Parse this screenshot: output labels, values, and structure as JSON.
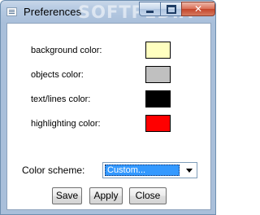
{
  "window": {
    "title": "Preferences",
    "watermark": "SOFTPEDIA"
  },
  "properties": [
    {
      "label": "background color:",
      "color": "#ffffc0"
    },
    {
      "label": "objects color:",
      "color": "#c0c0c0"
    },
    {
      "label": "text/lines color:",
      "color": "#000000"
    },
    {
      "label": "highlighting color:",
      "color": "#ff0000"
    }
  ],
  "scheme": {
    "label": "Color scheme:",
    "selected": "Custom..."
  },
  "buttons": {
    "save": "Save",
    "apply": "Apply",
    "close": "Close"
  },
  "icons": {
    "app": "window-app-icon",
    "minimize": "minimize-icon",
    "maximize": "maximize-icon",
    "close": "close-icon",
    "dropdown": "chevron-down-icon"
  }
}
